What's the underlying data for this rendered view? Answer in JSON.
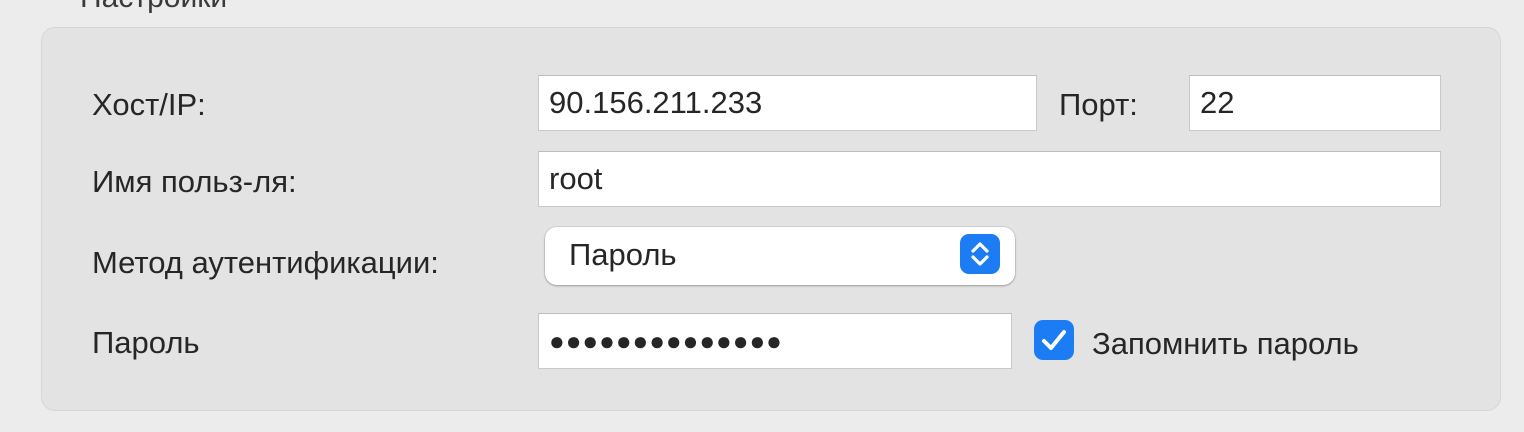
{
  "section": {
    "title": "Настройки"
  },
  "host": {
    "label": "Хост/IP:",
    "value": "90.156.211.233"
  },
  "port": {
    "label": "Порт:",
    "value": "22"
  },
  "username": {
    "label": "Имя польз-ля:",
    "value": "root"
  },
  "auth_method": {
    "label": "Метод аутентификации:",
    "selected": "Пароль",
    "icon": "up-down-chevron-icon"
  },
  "password": {
    "label": "Пароль",
    "masked_value": "●●●●●●●●●●●●●●",
    "remember_label": "Запомнить пароль",
    "remember_checked": true,
    "checkbox_icon": "checkmark-icon"
  },
  "colors": {
    "accent": "#1b7cf3",
    "background": "#ececec",
    "group_box": "#e3e3e3"
  }
}
